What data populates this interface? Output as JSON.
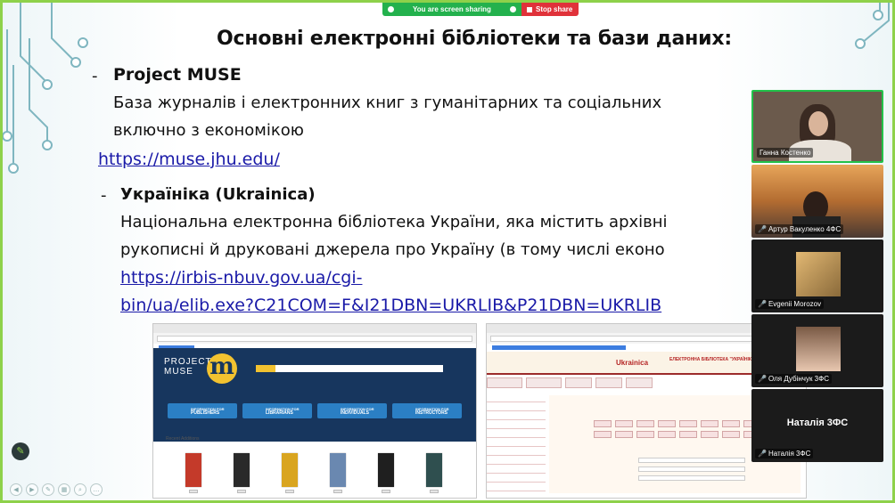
{
  "screen_share": {
    "status_text": "You are screen sharing",
    "stop_label": "Stop share",
    "colors": {
      "on": "#23b14d",
      "stop": "#e0323a"
    }
  },
  "slide": {
    "title": "Основні електронні бібліотеки та бази даних:",
    "items": [
      {
        "bullet": "-",
        "heading": "Project MUSE",
        "desc_line1": "База журналів і електронних книг з гуманітарних та соціальних",
        "desc_line2": "включно з економікою",
        "link": "https://muse.jhu.edu/"
      },
      {
        "bullet": "-",
        "heading": "Україніка (Ukrainica)",
        "desc_line1": "Національна електронна бібліотека України, яка містить архівні",
        "desc_line2": "рукописні й друковані джерела про Україну (в тому числі еконо",
        "link_line1": "https://irbis-nbuv.gov.ua/cgi-",
        "link_line2": "bin/ua/elib.exe?C21COM=F&I21DBN=UKRLIB&P21DBN=UKRLIB"
      }
    ]
  },
  "muse_screenshot": {
    "logo_line1": "PROJECT",
    "logo_line2": "MUSE",
    "logo_mark": "m",
    "buttons": [
      {
        "top": "INFORMATION FOR",
        "bottom": "PUBLISHERS"
      },
      {
        "top": "INFORMATION FOR",
        "bottom": "LIBRARIANS"
      },
      {
        "top": "INFORMATION FOR",
        "bottom": "INDIVIDUALS"
      },
      {
        "top": "INFORMATION FOR",
        "bottom": "INSTRUCTORS"
      }
    ],
    "recent_label": "Recent Additions",
    "book_colors": [
      "#c43a2a",
      "#2a2a2a",
      "#d9a520",
      "#6a88b0",
      "#1f1f1f",
      "#2f4f4f"
    ]
  },
  "nbuv_screenshot": {
    "logo_text": "Ukrainica",
    "header_text": "ЕЛЕКТРОННА БІБЛІОТЕКА \"УКРАЇНІКА\""
  },
  "participants": [
    {
      "name": "Ганна Костенко",
      "active": true,
      "bg": "#6b5a4c",
      "muted": false
    },
    {
      "name": "Артур Вакуленко 4ФС",
      "active": false,
      "bg": "#c9853a",
      "muted": true
    },
    {
      "name": "Evgenii Morozov",
      "active": false,
      "bg": "#1b1b1b",
      "muted": true
    },
    {
      "name": "Оля Дубінчук 3ФС",
      "active": false,
      "bg": "#1b1b1b",
      "muted": true
    },
    {
      "name": "Наталія 3ФС",
      "active": false,
      "bg": "#1b1b1b",
      "muted": true,
      "center_label": "Наталія 3ФС"
    }
  ]
}
